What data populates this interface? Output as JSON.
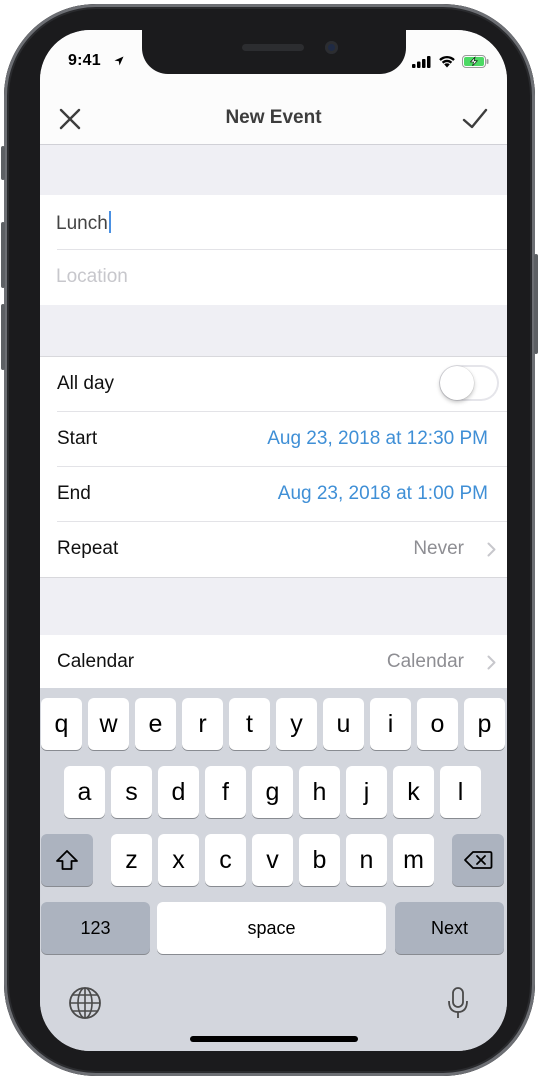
{
  "status_bar": {
    "time": "9:41"
  },
  "nav": {
    "title": "New Event"
  },
  "event": {
    "title_value": "Lunch",
    "location_placeholder": "Location"
  },
  "details": {
    "all_day_label": "All day",
    "all_day_on": false,
    "start_label": "Start",
    "start_value": "Aug 23, 2018 at 12:30 PM",
    "end_label": "End",
    "end_value": "Aug 23, 2018 at 1:00 PM",
    "repeat_label": "Repeat",
    "repeat_value": "Never"
  },
  "calendar": {
    "label": "Calendar",
    "value": "Calendar"
  },
  "keyboard": {
    "row1": [
      "q",
      "w",
      "e",
      "r",
      "t",
      "y",
      "u",
      "i",
      "o",
      "p"
    ],
    "row2": [
      "a",
      "s",
      "d",
      "f",
      "g",
      "h",
      "j",
      "k",
      "l"
    ],
    "row3": [
      "z",
      "x",
      "c",
      "v",
      "b",
      "n",
      "m"
    ],
    "numbers_key": "123",
    "space_key": "space",
    "return_key": "Next"
  },
  "colors": {
    "accent": "#3f8fd6",
    "muted": "#8e8e93",
    "background": "#efeff4",
    "keyboard_bg": "#d3d6dd"
  }
}
